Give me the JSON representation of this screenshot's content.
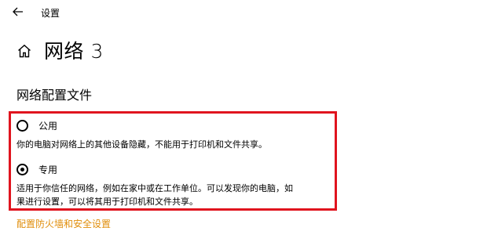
{
  "app": {
    "title": "设置"
  },
  "icons": {
    "back": "back-arrow-icon",
    "home": "home-icon"
  },
  "page": {
    "title": "网络 3"
  },
  "network_profile": {
    "heading": "网络配置文件",
    "options": [
      {
        "label": "公用",
        "selected": false,
        "description": "你的电脑对网络上的其他设备隐藏，不能用于打印机和文件共享。"
      },
      {
        "label": "专用",
        "selected": true,
        "description_line1": "适用于你信任的网络，例如在家中或在工作单位。可以发现你的电脑，如",
        "description_line2": "果进行设置，可以将其用于打印机和文件共享。"
      }
    ]
  },
  "firewall_link": {
    "label": "配置防火墙和安全设置"
  },
  "colors": {
    "highlight_border": "#e0141e",
    "link": "#e08e0b"
  }
}
